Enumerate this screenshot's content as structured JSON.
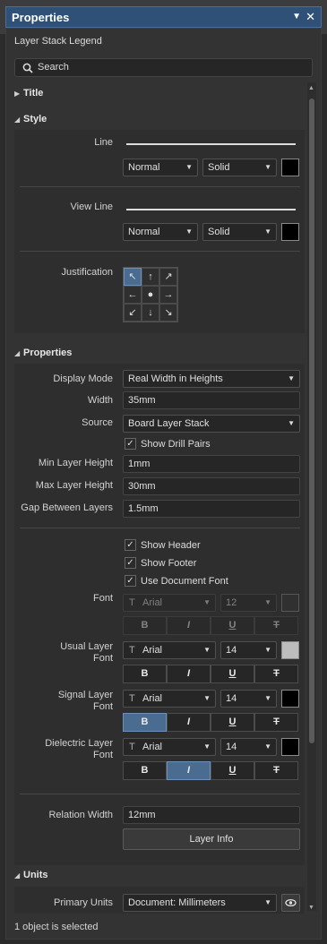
{
  "panel": {
    "title": "Properties",
    "menu_icon": "▼",
    "close_icon": "✕",
    "object_name": "Layer Stack Legend",
    "search_placeholder": "Search"
  },
  "sections": {
    "title": "Title",
    "style": "Style",
    "properties": "Properties",
    "units": "Units"
  },
  "style": {
    "line_label": "Line",
    "line_style": "Normal",
    "line_type": "Solid",
    "view_line_label": "View Line",
    "view_line_style": "Normal",
    "view_line_type": "Solid",
    "justification_label": "Justification",
    "justification_glyphs": [
      "↖",
      "↑",
      "↗",
      "←",
      "●",
      "→",
      "↙",
      "↓",
      "↘"
    ]
  },
  "props": {
    "display_mode_label": "Display Mode",
    "display_mode": "Real Width in Heights",
    "width_label": "Width",
    "width": "35mm",
    "source_label": "Source",
    "source": "Board Layer Stack",
    "show_drill_pairs": "Show Drill Pairs",
    "min_layer_label": "Min Layer Height",
    "min_layer": "1mm",
    "max_layer_label": "Max Layer Height",
    "max_layer": "30mm",
    "gap_label": "Gap Between Layers",
    "gap": "1.5mm",
    "show_header": "Show Header",
    "show_footer": "Show Footer",
    "use_doc_font": "Use Document Font",
    "font_label": "Font",
    "usual_layer_label_1": "Usual Layer",
    "usual_layer_label_2": "Font",
    "signal_layer_label_1": "Signal Layer",
    "signal_layer_label_2": "Font",
    "dielectric_layer_label_1": "Dielectric Layer",
    "dielectric_layer_label_2": "Font",
    "font_name": "Arial",
    "font_size_disabled": "12",
    "font_size": "14",
    "tt_icon": "T",
    "bold": "B",
    "italic": "I",
    "underline": "U",
    "strike": "T",
    "relation_width_label": "Relation Width",
    "relation_width": "12mm",
    "layer_info": "Layer Info"
  },
  "units": {
    "primary_label": "Primary Units",
    "primary": "Document: Millimeters"
  },
  "status": "1 object is selected",
  "colors": {
    "accent": "#4a6c90",
    "titlebar": "#2f5077"
  }
}
